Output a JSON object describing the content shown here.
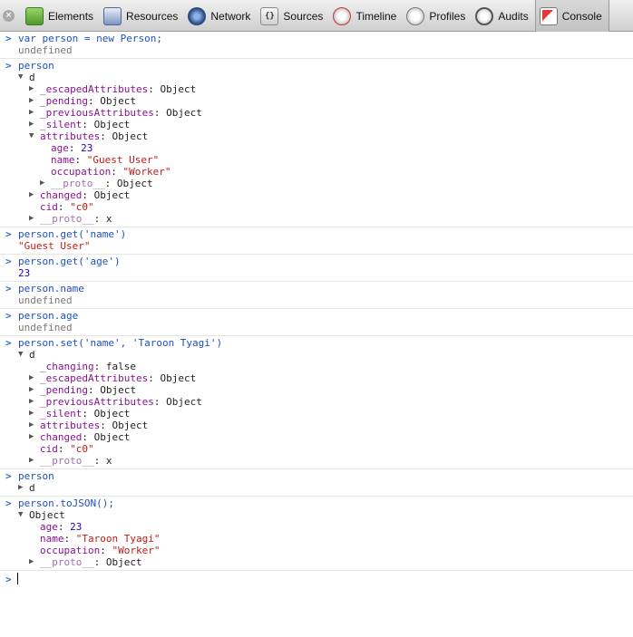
{
  "toolbar": {
    "tabs": [
      {
        "label": "Elements"
      },
      {
        "label": "Resources"
      },
      {
        "label": "Network"
      },
      {
        "label": "Sources"
      },
      {
        "label": "Timeline"
      },
      {
        "label": "Profiles"
      },
      {
        "label": "Audits"
      },
      {
        "label": "Console"
      }
    ],
    "active": "Console",
    "close_glyph": "×"
  },
  "console": {
    "c1": {
      "input": "var person = new Person;",
      "out": "undefined"
    },
    "c2": {
      "input": "person",
      "root": "d",
      "p1": "_escapedAttributes",
      "p1v": "Object",
      "p2": "_pending",
      "p2v": "Object",
      "p3": "_previousAttributes",
      "p3v": "Object",
      "p4": "_silent",
      "p4v": "Object",
      "p5": "attributes",
      "p5v": "Object",
      "a1": "age",
      "a1v": "23",
      "a2": "name",
      "a2v": "\"Guest User\"",
      "a3": "occupation",
      "a3v": "\"Worker\"",
      "a4": "__proto__",
      "a4v": "Object",
      "p6": "changed",
      "p6v": "Object",
      "p7": "cid",
      "p7v": "\"c0\"",
      "p8": "__proto__",
      "p8v": "x"
    },
    "c3": {
      "input": "person.get('name')",
      "out": "\"Guest User\""
    },
    "c4": {
      "input": "person.get('age')",
      "out": "23"
    },
    "c5": {
      "input": "person.name",
      "out": "undefined"
    },
    "c6": {
      "input": "person.age",
      "out": "undefined"
    },
    "c7": {
      "input": "person.set('name', 'Taroon Tyagi')",
      "root": "d",
      "p0": "_changing",
      "p0v": "false",
      "p1": "_escapedAttributes",
      "p1v": "Object",
      "p2": "_pending",
      "p2v": "Object",
      "p3": "_previousAttributes",
      "p3v": "Object",
      "p4": "_silent",
      "p4v": "Object",
      "p5": "attributes",
      "p5v": "Object",
      "p6": "changed",
      "p6v": "Object",
      "p7": "cid",
      "p7v": "\"c0\"",
      "p8": "__proto__",
      "p8v": "x"
    },
    "c8": {
      "input": "person",
      "root": "d"
    },
    "c9": {
      "input": "person.toJSON();",
      "root": "Object",
      "a1": "age",
      "a1v": "23",
      "a2": "name",
      "a2v": "\"Taroon Tyagi\"",
      "a3": "occupation",
      "a3v": "\"Worker\"",
      "a4": "__proto__",
      "a4v": "Object"
    },
    "prompt_glyph": ">",
    "expanded_glyph": "▼",
    "collapsed_glyph": "▶",
    "colon": ": "
  }
}
